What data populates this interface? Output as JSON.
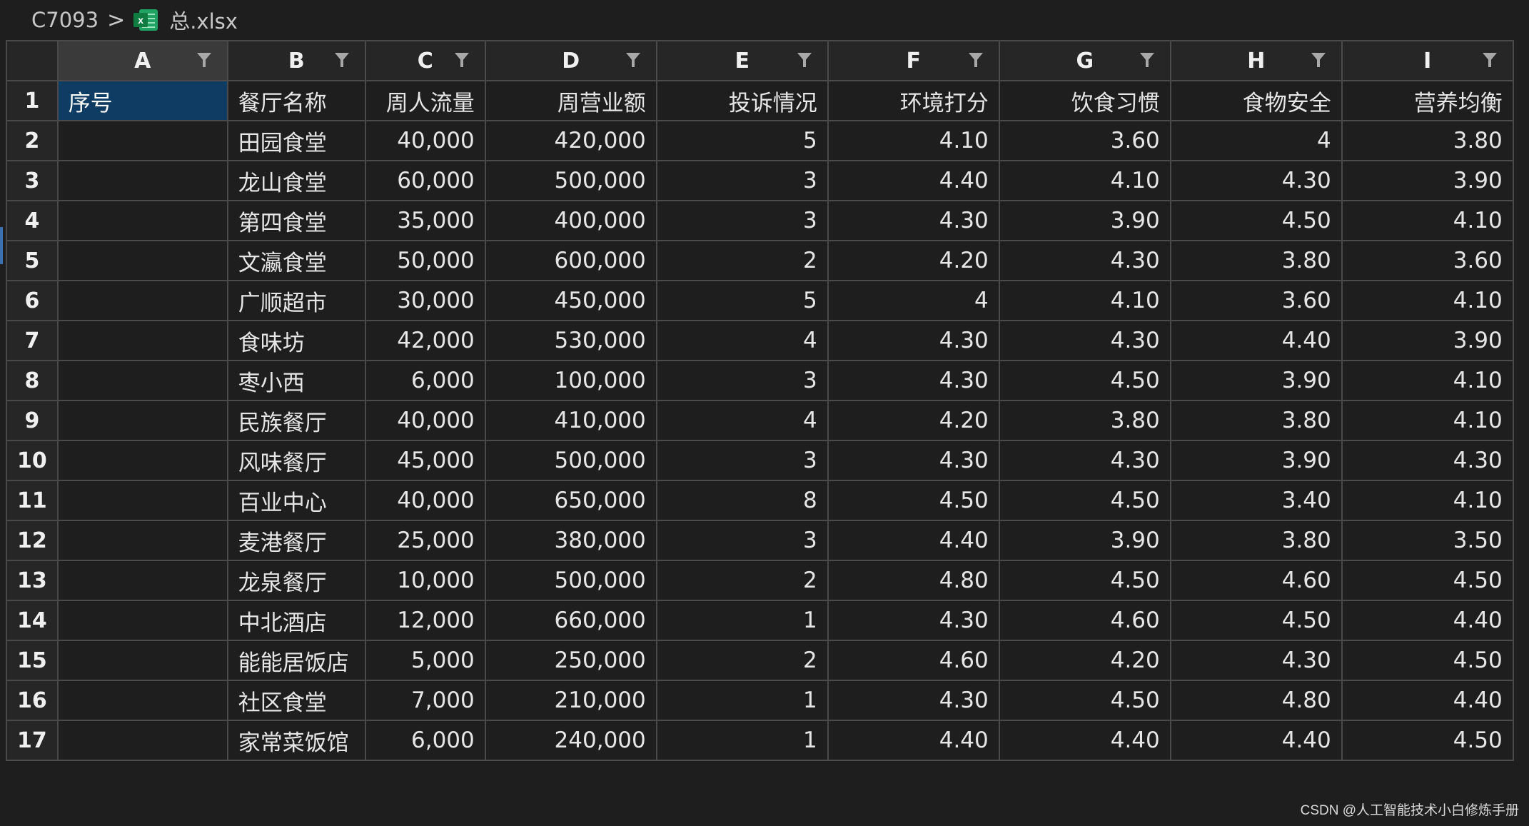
{
  "breadcrumb": {
    "folder": "C7093",
    "separator": ">",
    "file_icon": "excel-file-icon",
    "file_name": "总.xlsx"
  },
  "columns": [
    "A",
    "B",
    "C",
    "D",
    "E",
    "F",
    "G",
    "H",
    "I"
  ],
  "header_row": [
    "序号",
    "餐厅名称",
    "周人流量",
    "周营业额",
    "投诉情况",
    "环境打分",
    "饮食习惯",
    "食物安全",
    "营养均衡"
  ],
  "rows": [
    {
      "num": "2",
      "cells": [
        "",
        "田园食堂",
        "40,000",
        "420,000",
        "5",
        "4.10",
        "3.60",
        "4",
        "3.80"
      ]
    },
    {
      "num": "3",
      "cells": [
        "",
        "龙山食堂",
        "60,000",
        "500,000",
        "3",
        "4.40",
        "4.10",
        "4.30",
        "3.90"
      ]
    },
    {
      "num": "4",
      "cells": [
        "",
        "第四食堂",
        "35,000",
        "400,000",
        "3",
        "4.30",
        "3.90",
        "4.50",
        "4.10"
      ]
    },
    {
      "num": "5",
      "cells": [
        "",
        "文瀛食堂",
        "50,000",
        "600,000",
        "2",
        "4.20",
        "4.30",
        "3.80",
        "3.60"
      ]
    },
    {
      "num": "6",
      "cells": [
        "",
        "广顺超市",
        "30,000",
        "450,000",
        "5",
        "4",
        "4.10",
        "3.60",
        "4.10"
      ]
    },
    {
      "num": "7",
      "cells": [
        "",
        "食味坊",
        "42,000",
        "530,000",
        "4",
        "4.30",
        "4.30",
        "4.40",
        "3.90"
      ]
    },
    {
      "num": "8",
      "cells": [
        "",
        "枣小西",
        "6,000",
        "100,000",
        "3",
        "4.30",
        "4.50",
        "3.90",
        "4.10"
      ]
    },
    {
      "num": "9",
      "cells": [
        "",
        "民族餐厅",
        "40,000",
        "410,000",
        "4",
        "4.20",
        "3.80",
        "3.80",
        "4.10"
      ]
    },
    {
      "num": "10",
      "cells": [
        "",
        "风味餐厅",
        "45,000",
        "500,000",
        "3",
        "4.30",
        "4.30",
        "3.90",
        "4.30"
      ]
    },
    {
      "num": "11",
      "cells": [
        "",
        "百业中心",
        "40,000",
        "650,000",
        "8",
        "4.50",
        "4.50",
        "3.40",
        "4.10"
      ]
    },
    {
      "num": "12",
      "cells": [
        "",
        "麦港餐厅",
        "25,000",
        "380,000",
        "3",
        "4.40",
        "3.90",
        "3.80",
        "3.50"
      ]
    },
    {
      "num": "13",
      "cells": [
        "",
        "龙泉餐厅",
        "10,000",
        "500,000",
        "2",
        "4.80",
        "4.50",
        "4.60",
        "4.50"
      ]
    },
    {
      "num": "14",
      "cells": [
        "",
        "中北酒店",
        "12,000",
        "660,000",
        "1",
        "4.30",
        "4.60",
        "4.50",
        "4.40"
      ]
    },
    {
      "num": "15",
      "cells": [
        "",
        "能能居饭店",
        "5,000",
        "250,000",
        "2",
        "4.60",
        "4.20",
        "4.30",
        "4.50"
      ]
    },
    {
      "num": "16",
      "cells": [
        "",
        "社区食堂",
        "7,000",
        "210,000",
        "1",
        "4.30",
        "4.50",
        "4.80",
        "4.40"
      ]
    },
    {
      "num": "17",
      "cells": [
        "",
        "家常菜饭馆",
        "6,000",
        "240,000",
        "1",
        "4.40",
        "4.40",
        "4.40",
        "4.50"
      ]
    }
  ],
  "header_row_num": "1",
  "selected_cell": "A1",
  "watermark": "CSDN @人工智能技术小白修炼手册"
}
